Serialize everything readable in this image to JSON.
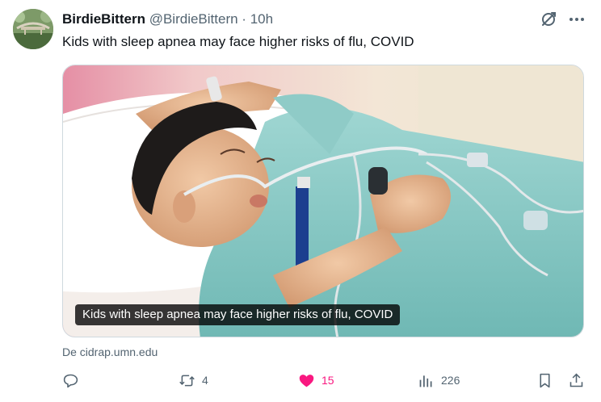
{
  "post": {
    "author_name": "BirdieBittern",
    "author_handle": "@BirdieBittern",
    "separator": "·",
    "time": "10h",
    "text": "Kids with sleep apnea may face higher risks of flu, COVID",
    "media_caption": "Kids with sleep apnea may face higher risks of flu, COVID",
    "source": "De cidrap.umn.edu"
  },
  "actions": {
    "reply_count": "",
    "repost_count": "4",
    "like_count": "15",
    "views_count": "226"
  },
  "colors": {
    "like_active": "#f91880",
    "secondary_text": "#536471",
    "primary_text": "#0f1419"
  },
  "icons": [
    "grok-icon",
    "more-icon",
    "reply-icon",
    "repost-icon",
    "heart-icon",
    "views-icon",
    "bookmark-icon",
    "share-icon"
  ]
}
